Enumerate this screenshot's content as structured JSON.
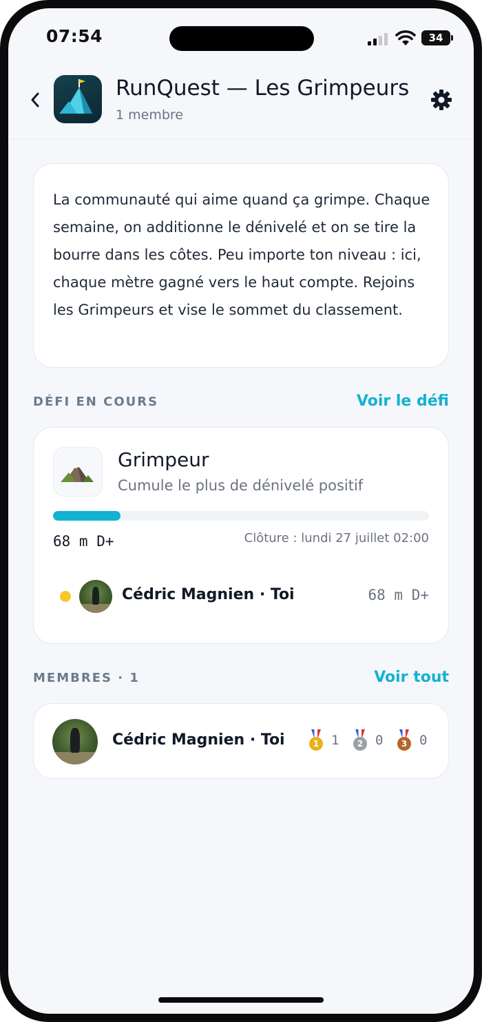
{
  "status_bar": {
    "time": "07:54",
    "battery": "34"
  },
  "header": {
    "title": "RunQuest — Les Grimpeurs",
    "subtitle": "1 membre"
  },
  "description": "La communauté qui aime quand ça grimpe. Chaque semaine, on additionne le dénivelé et on se tire la bourre dans les côtes. Peu importe ton niveau : ici, chaque mètre gagné vers le haut compte. Rejoins les Grimpeurs et vise le sommet du classement.",
  "challenge_section": {
    "label": "DÉFI EN COURS",
    "link": "Voir le défi"
  },
  "challenge": {
    "title": "Grimpeur",
    "subtitle": "Cumule le plus de dénivelé positif",
    "progress_fraction": 0.18,
    "value": "68 m D+",
    "closing": "Clôture : lundi 27 juillet 02:00",
    "leader": {
      "name": "Cédric Magnien · Toi",
      "value": "68 m D+"
    }
  },
  "members_section": {
    "label": "MEMBRES · 1",
    "link": "Voir tout"
  },
  "members": [
    {
      "name": "Cédric Magnien · Toi",
      "medals": {
        "gold": "1",
        "silver": "0",
        "bronze": "0"
      }
    }
  ],
  "colors": {
    "accent": "#12b2d0",
    "background": "#f5f7fb",
    "gold": "#e9b21a",
    "silver": "#9aa0a6",
    "bronze": "#b5652a"
  },
  "icons": {
    "back": "chevron-left-icon",
    "settings": "gear-icon",
    "challenge": "mountain-icon"
  }
}
